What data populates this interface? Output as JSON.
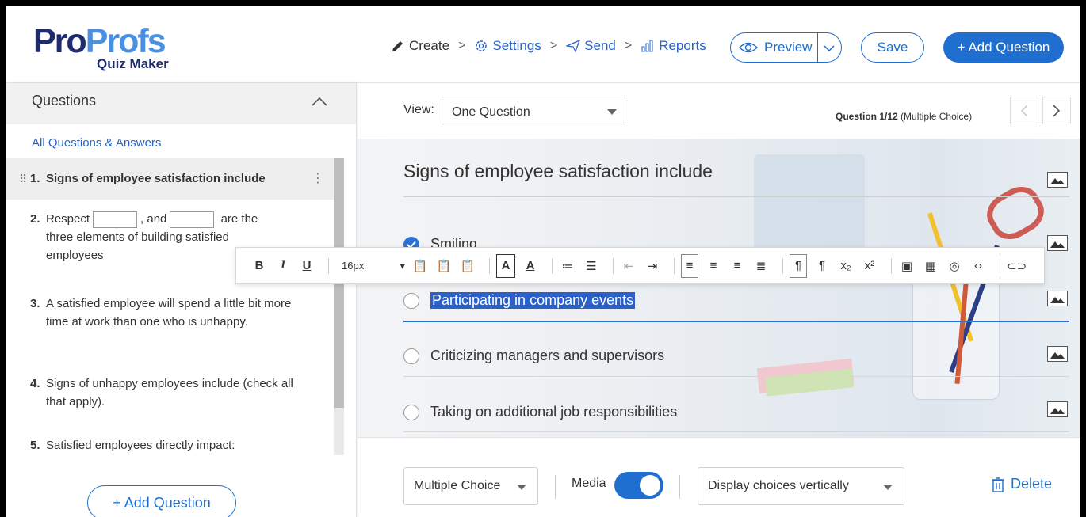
{
  "header": {
    "logo_part1": "Pro",
    "logo_part2": "Profs",
    "logo_sub": "Quiz Maker",
    "steps": [
      "Create",
      "Settings",
      "Send",
      "Reports"
    ],
    "step_separator": ">",
    "preview_label": "Preview",
    "save_label": "Save",
    "add_question_label": "+ Add Question"
  },
  "sidebar": {
    "title": "Questions",
    "all_link": "All Questions & Answers",
    "items": [
      {
        "num": "1.",
        "text": "Signs of employee satisfaction include"
      },
      {
        "num": "2.",
        "pre": "Respect",
        "mid": ", and",
        "post": "are the",
        "line2": "three elements of building satisfied",
        "line3": "employees"
      },
      {
        "num": "3.",
        "text": "A satisfied employee will spend a little bit more time at work than one who is unhappy."
      },
      {
        "num": "4.",
        "text": "Signs of unhappy employees include (check all that apply)."
      },
      {
        "num": "5.",
        "text": "Satisfied employees directly impact:"
      }
    ],
    "add_question_label": "+ Add Question"
  },
  "main": {
    "view_label": "View:",
    "view_value": "One Question",
    "question_counter_bold": "Question 1/12",
    "question_counter_type": "(Multiple Choice)",
    "question_title": "Signs of employee satisfaction include",
    "choices": [
      {
        "text": "Smiling",
        "checked": true
      },
      {
        "text": "Participating in company events",
        "checked": false
      },
      {
        "text": "Criticizing managers and supervisors",
        "checked": false
      },
      {
        "text": "Taking on additional job responsibilities",
        "checked": false
      }
    ]
  },
  "toolbar": {
    "bold": "B",
    "italic": "I",
    "underline": "U",
    "font_size": "16px"
  },
  "bottom": {
    "question_type": "Multiple Choice",
    "media_label": "Media",
    "media_on": true,
    "display_value": "Display choices vertically",
    "delete_label": "Delete"
  },
  "colors": {
    "accent": "#1f6fd1",
    "logo_dark": "#1e2c6e",
    "logo_light": "#4a90e2",
    "highlight": "#2a60c7"
  }
}
